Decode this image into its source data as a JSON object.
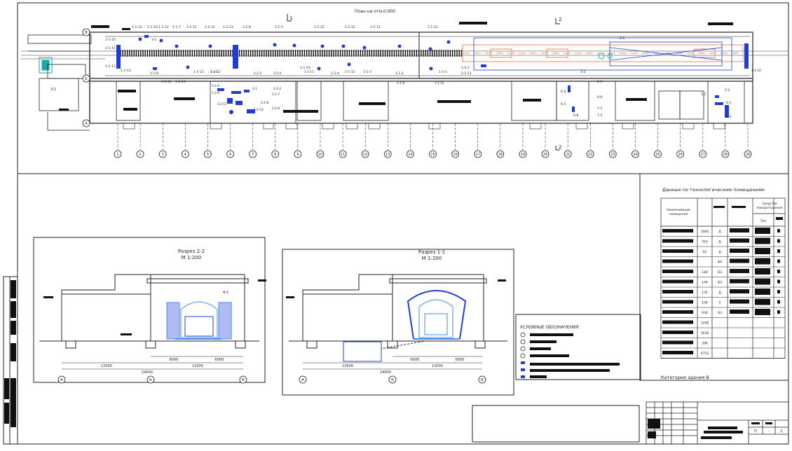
{
  "plan": {
    "title": "План на отм.0,000",
    "axes_cols": [
      "1",
      "2",
      "3",
      "4",
      "5",
      "6",
      "7",
      "8",
      "9",
      "10",
      "11",
      "12",
      "13",
      "14",
      "15",
      "16",
      "17",
      "18",
      "19",
      "20",
      "21",
      "22",
      "23",
      "24",
      "25",
      "26",
      "27",
      "28",
      "29"
    ],
    "axes_rows": [
      "В",
      "Б",
      "А"
    ],
    "section_marks": [
      "1",
      "2",
      "2"
    ],
    "tags_top": [
      "1-1-12",
      "1-1-10",
      "1-1-12",
      "1-1-7",
      "1-1-11",
      "1-1-12",
      "1-1-13",
      "1-1-8",
      "1-1-5",
      "1-1-12",
      "1-1-12",
      "1-1-11",
      "1-1-12"
    ],
    "tags_mid": [
      "1-1-10",
      "1-1-11",
      "1-1-11",
      "1-1-12",
      "1-1-9",
      "1-1-12",
      "1-1-13",
      "1-1-13",
      "1-1-12",
      "1-1-13",
      "1-1-4",
      "1-1-11",
      "1-1-3",
      "1-1-2",
      "1-1-1",
      "1-1-1",
      "1-1-11"
    ],
    "tags_right": [
      "4-1",
      "3-2",
      "3-1",
      "5-1",
      "5-2",
      "6-1",
      "6-2",
      "6-3",
      "6-5",
      "6-6",
      "6-4",
      "7-1",
      "7-2",
      "6-8"
    ],
    "aux_tags": [
      "1-2-1",
      "1-2-3",
      "1-2-4",
      "1-2-5",
      "1-2-6",
      "1-2-7",
      "1-2-8",
      "1-2-9",
      "1-2-10",
      "1-2-11",
      "1-2-2",
      "2-1",
      "1-1-8",
      "1-1-10",
      "1-1-11",
      "1-1-12"
    ],
    "lateral_label": "3-1"
  },
  "section_22": {
    "title": "Разрез 2-2",
    "scale": "М 1:200",
    "tag": "4-1",
    "dims_upper": [
      "6000",
      "6000"
    ],
    "dims_mid": [
      "12000",
      "12000"
    ],
    "dim_total": "24000",
    "axes": [
      "А",
      "Б",
      "В"
    ]
  },
  "section_11": {
    "title": "Разрез 1-1",
    "scale": "М 1:200",
    "dims_upper": [
      "6000",
      "6000"
    ],
    "dims_mid": [
      "12000",
      "12000"
    ],
    "dim_total": "24000",
    "axes": [
      "А",
      "Б",
      "В"
    ]
  },
  "legend": {
    "title": "УСЛОВНЫЕ   ОБОЗНАЧЕНИЯ"
  },
  "rooms_table": {
    "title": "Данные по технологическим помещениям",
    "col_name": "Наименование помещения",
    "col_fire": "Средства пожаротушения",
    "col_type": "Тип",
    "rows": [
      {
        "area": "1060",
        "cat": "Д"
      },
      {
        "area": "316",
        "cat": "Д"
      },
      {
        "area": "92",
        "cat": "Д"
      },
      {
        "area": "",
        "cat": "В4"
      },
      {
        "area": "180",
        "cat": "В3"
      },
      {
        "area": "144",
        "cat": "В3"
      },
      {
        "area": "135",
        "cat": "Д"
      },
      {
        "area": "108",
        "cat": "А"
      },
      {
        "area": "936",
        "cat": "В3"
      },
      {
        "area": "1448",
        "cat": "-"
      },
      {
        "area": "3638",
        "cat": ""
      },
      {
        "area": "396",
        "cat": ""
      },
      {
        "area": "4752",
        "cat": ""
      }
    ],
    "footer": "Категория здания В"
  },
  "stamp": {
    "sheet_cells": [
      "П",
      "-",
      "1"
    ]
  },
  "colors": {
    "line": "#222222",
    "equipment": "#1f3cd6",
    "equipment_light": "#3f8ef0",
    "orange": "#f08a5a",
    "teal": "#1aa8a8",
    "redact": "#111111"
  }
}
